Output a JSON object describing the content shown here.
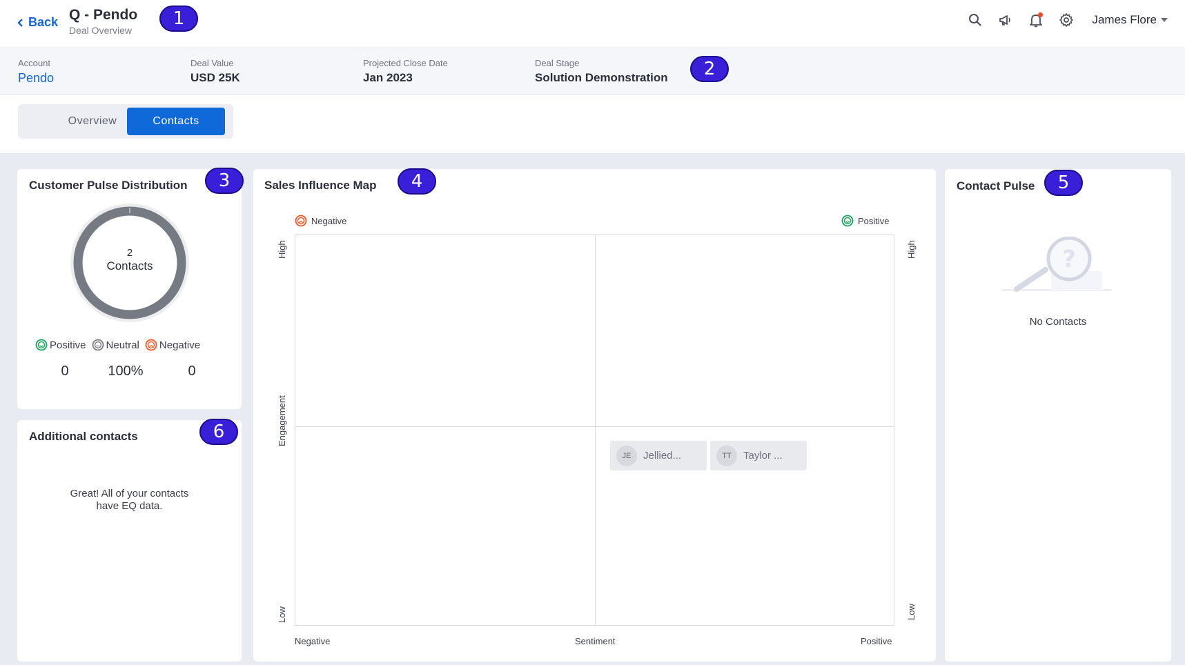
{
  "header": {
    "back_label": "Back",
    "title": "Q - Pendo",
    "subtitle": "Deal Overview",
    "user_name": "James Flore",
    "icons": [
      "search-icon",
      "megaphone-icon",
      "bell-icon",
      "gear-icon"
    ]
  },
  "badges": [
    "1",
    "2",
    "3",
    "4",
    "5",
    "6"
  ],
  "deal": {
    "account_label": "Account",
    "account_value": "Pendo",
    "value_label": "Deal Value",
    "value_value": "USD 25K",
    "close_label": "Projected Close Date",
    "close_value": "Jan 2023",
    "stage_label": "Deal Stage",
    "stage_value": "Solution Demonstration"
  },
  "tabs": {
    "overview": "Overview",
    "contacts": "Contacts",
    "active": "Contacts"
  },
  "pulse_distribution": {
    "title": "Customer Pulse Distribution",
    "center_count": "2",
    "center_label": "Contacts",
    "legend": {
      "positive": "Positive",
      "neutral": "Neutral",
      "negative": "Negative"
    },
    "values": {
      "positive": "0",
      "neutral": "100%",
      "negative": "0"
    }
  },
  "additional_contacts": {
    "title": "Additional contacts",
    "message": "Great! All of your contacts have EQ data."
  },
  "influence_map": {
    "title": "Sales Influence Map",
    "legend_negative": "Negative",
    "legend_positive": "Positive",
    "y_axis_label": "Engagement",
    "y_high": "High",
    "y_low": "Low",
    "x_axis_label": "Sentiment",
    "x_negative": "Negative",
    "x_positive": "Positive",
    "contacts": [
      {
        "initials": "JE",
        "name": "Jellied..."
      },
      {
        "initials": "TT",
        "name": "Taylor ..."
      }
    ]
  },
  "contact_pulse": {
    "title": "Contact Pulse",
    "empty_text": "No Contacts"
  },
  "colors": {
    "accent": "#1069d8",
    "badge": "#3a1fd9",
    "positive": "#1aa35b",
    "neutral": "#7b7e87",
    "negative": "#ec5a2b",
    "content_bg": "#e9ebf2"
  }
}
